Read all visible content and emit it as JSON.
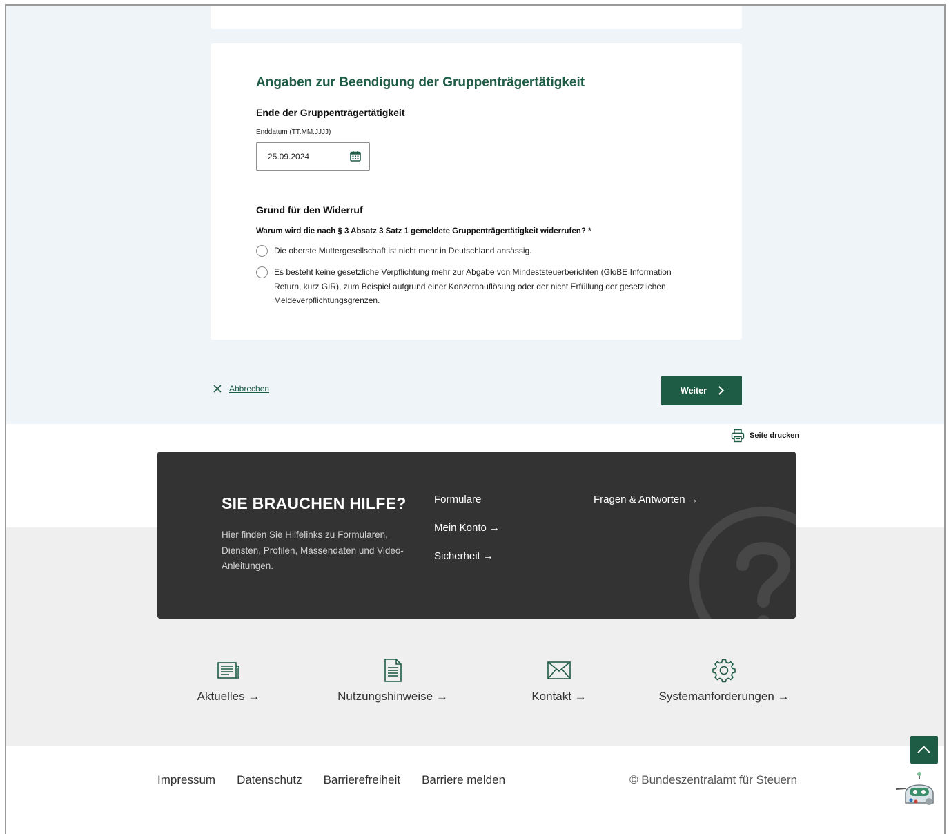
{
  "form": {
    "section_title": "Angaben zur Beendigung der Gruppenträgertätigkeit",
    "end_subtitle": "Ende der Gruppenträgertätigkeit",
    "date_label": "Enddatum (TT.MM.JJJJ)",
    "date_value": "25.09.2024",
    "reason_title": "Grund für den Widerruf",
    "question": "Warum wird die nach § 3 Absatz 3 Satz 1 gemeldete Gruppenträgertätigkeit widerrufen? *",
    "options": [
      "Die oberste Muttergesellschaft ist nicht mehr in Deutschland ansässig.",
      "Es besteht keine gesetzliche Verpflichtung mehr zur Abgabe von Mindeststeuerberichten (GloBE Information Return, kurz GIR), zum Beispiel aufgrund einer Konzernauflösung oder der nicht Erfüllung der gesetzlichen Meldeverpflichtungsgrenzen."
    ]
  },
  "actions": {
    "cancel": "Abbrechen",
    "next": "Weiter",
    "print": "Seite drucken"
  },
  "help": {
    "title": "SIE BRAUCHEN HILFE?",
    "text": "Hier finden Sie Hilfelinks zu Formularen, Diensten, Profilen, Massendaten und Video-Anleitungen.",
    "links": [
      "Formulare",
      "Mein Konto →",
      "Sicherheit →",
      "Fragen & Antworten →"
    ]
  },
  "footer_links": [
    "Aktuelles →",
    "Nutzungshinweise →",
    "Kontakt →",
    "Systemanforderungen →"
  ],
  "legal": [
    "Impressum",
    "Datenschutz",
    "Barrierefreiheit",
    "Barriere melden"
  ],
  "copyright": "© Bundeszentralamt für Steuern",
  "colors": {
    "accent": "#1f5c45",
    "help_bg": "#333333",
    "page_bg": "#eff4f8"
  },
  "icons": [
    "calendar-icon",
    "close-icon",
    "chevron-right-icon",
    "printer-icon",
    "question-icon",
    "newspaper-icon",
    "document-icon",
    "envelope-icon",
    "gear-icon",
    "chevron-up-icon",
    "robot-icon"
  ]
}
